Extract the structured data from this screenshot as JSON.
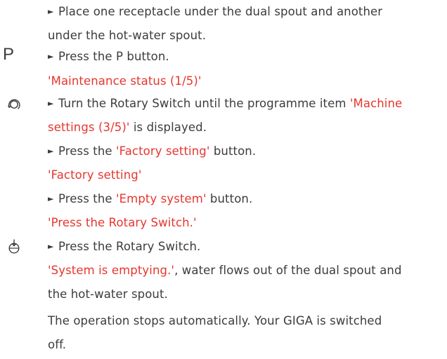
{
  "steps": [
    {
      "id": "s1",
      "line1": "Place one receptacle under the dual spout and another",
      "line2": "under the hot-water spout."
    },
    {
      "id": "s2",
      "icon": "P",
      "text": "Press the P button.",
      "status": "'Maintenance status (1/5)'"
    },
    {
      "id": "s3",
      "icon": "rotary-switch-turn-icon",
      "text_a": "Turn the Rotary Switch until the programme item ",
      "highlight": "'Machine",
      "highlight2": "settings (3/5)'",
      "text_b": " is displayed."
    },
    {
      "id": "s4",
      "text_a": "Press the ",
      "highlight": "'Factory setting'",
      "text_b": " button.",
      "status": "'Factory setting'"
    },
    {
      "id": "s5",
      "text_a": "Press the ",
      "highlight": "'Empty system'",
      "text_b": " button.",
      "status": "'Press the Rotary Switch.'"
    },
    {
      "id": "s6",
      "icon": "rotary-switch-press-icon",
      "text": "Press the Rotary Switch.",
      "status_red": "'System is emptying.'",
      "status_rest": ", water flows out of the dual spout and",
      "status_line2": "the hot-water spout.",
      "note_line1": "The operation stops automatically. Your GIGA is switched",
      "note_line2": "off."
    }
  ],
  "bullet": "►",
  "colors": {
    "text": "#3c3c3c",
    "highlight": "#e6362f"
  }
}
